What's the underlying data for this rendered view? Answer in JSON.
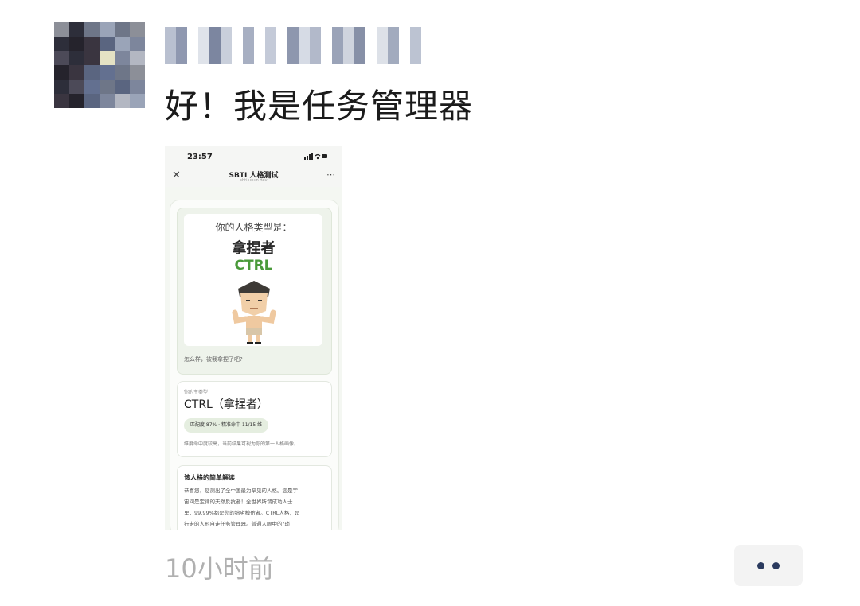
{
  "post": {
    "text": "好！我是任务管理器",
    "time": "10小时前"
  },
  "phone": {
    "status_time": "23:57",
    "status_icons": "signal-wifi-battery",
    "nav": {
      "close_icon": "close-icon",
      "title": "SBTI 人格测试",
      "subtitle": "sbti.unun.dev",
      "more_icon": "more-icon"
    },
    "result": {
      "label": "你的人格类型是：",
      "name": "拿捏者",
      "code": "CTRL",
      "caption": "怎么样，被我拿捏了吧?"
    },
    "detail": {
      "label": "你的主类型",
      "title": "CTRL（拿捏者）",
      "match": "匹配度 87% · 精准命中 11/15 维",
      "note": "维度命中度较高，当前结果可视为你的第一人格画像。"
    },
    "brief": {
      "title": "该人格的简单解读",
      "lines": [
        "恭喜您，您测出了全中国最为罕见的人格。您是宇",
        "宙间是定律的天然反抗者！全世界所谓成功人士",
        "里，99.99%都是您的拙劣模仿者。CTRL人格，是",
        "行走的人形自走任务管理器。普通人眼中的\"琐"
      ]
    }
  },
  "colors": {
    "accent_green": "#4a9a3a",
    "dots": "#2a3a5e"
  }
}
